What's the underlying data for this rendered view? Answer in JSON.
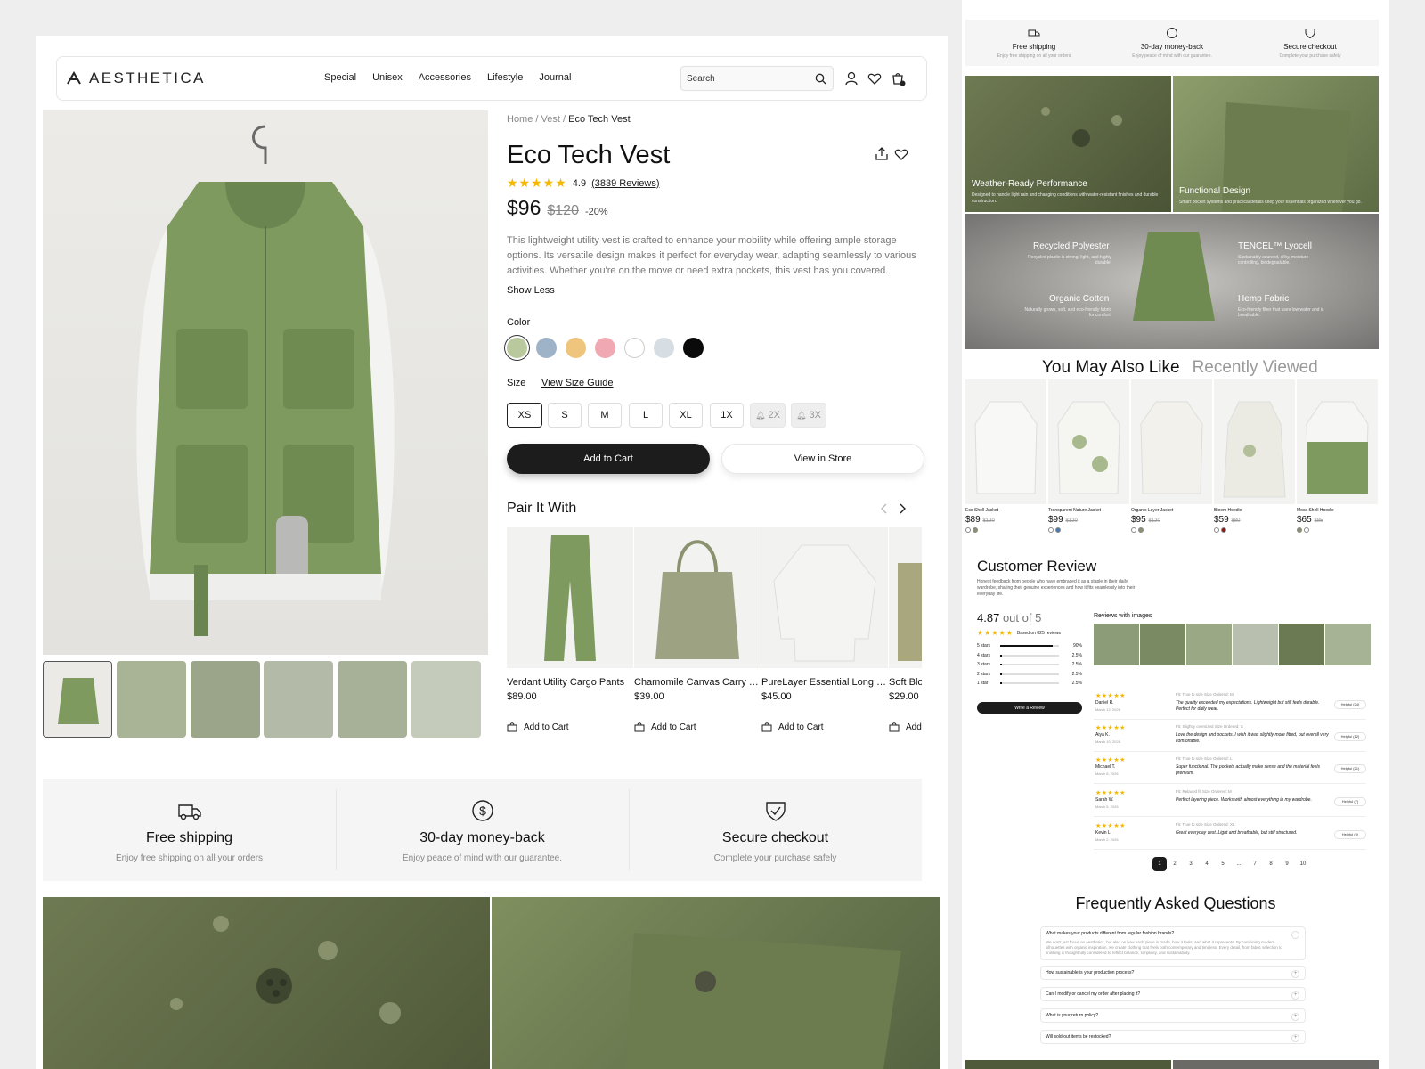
{
  "brand": "AESTHETICA",
  "nav": {
    "links": [
      "Special",
      "Unisex",
      "Accessories",
      "Lifestyle",
      "Journal"
    ],
    "search_placeholder": "Search"
  },
  "breadcrumb": {
    "home": "Home",
    "sep": "/",
    "vest": "Vest",
    "current": "Eco Tech Vest"
  },
  "product": {
    "title": "Eco Tech Vest",
    "rating": "4.9",
    "reviews_link": "(3839 Reviews)",
    "stars": "★★★★★",
    "price": "$96",
    "old_price": "$120",
    "discount": "-20%",
    "description": "This lightweight utility vest is crafted to enhance your mobility while offering ample storage options. Its versatile design makes it perfect for everyday wear, adapting seamlessly to various activities. Whether you're on the move or need extra pockets, this vest has you covered.",
    "show_less": "Show Less",
    "color_label": "Color",
    "colors": [
      "#b9c89d",
      "#9fb3c8",
      "#efc47c",
      "#f0a8b3",
      "#ffffff",
      "#d6dde3",
      "#0a0a0a"
    ],
    "size_label": "Size",
    "size_guide": "View Size Guide",
    "sizes": [
      "XS",
      "S",
      "M",
      "L",
      "XL",
      "1X",
      "2X",
      "3X"
    ],
    "add_to_cart": "Add to Cart",
    "view_in_store": "View in Store"
  },
  "pair": {
    "title": "Pair It With",
    "items": [
      {
        "name": "Verdant Utility Cargo Pants",
        "price": "$89.00",
        "action": "Add to Cart"
      },
      {
        "name": "Chamomile Canvas Carry T...",
        "price": "$39.00",
        "action": "Add to Cart"
      },
      {
        "name": "PureLayer Essential Long Sl...",
        "price": "$45.00",
        "action": "Add to Cart"
      },
      {
        "name": "Soft Blo",
        "price": "$29.00",
        "action": "Add"
      }
    ]
  },
  "features": [
    {
      "title": "Free shipping",
      "sub": "Enjoy free shipping on all your orders"
    },
    {
      "title": "30-day money-back",
      "sub": "Enjoy peace of mind with our guarantee."
    },
    {
      "title": "Secure checkout",
      "sub": "Complete your purchase safely"
    }
  ],
  "right": {
    "overlays": [
      {
        "title": "Weather-Ready Performance",
        "sub": "Designed to handle light rain and changing conditions with water-resistant finishes and durable construction."
      },
      {
        "title": "Functional Design",
        "sub": "Smart pocket systems and practical details keep your essentials organized wherever you go."
      }
    ],
    "materials": [
      {
        "title": "Recycled Polyester",
        "sub": "Recycled plastic is strong, light, and highly durable."
      },
      {
        "title": "TENCEL™ Lyocell",
        "sub": "Sustainably sourced, silky, moisture-controlling, biodegradable."
      },
      {
        "title": "Organic Cotton",
        "sub": "Naturally grown, soft, and eco-friendly fabric for comfort."
      },
      {
        "title": "Hemp Fabric",
        "sub": "Eco-friendly fiber that uses low water and is breathable."
      }
    ],
    "tabs": [
      "You May Also Like",
      "Recently Viewed"
    ],
    "recs": [
      {
        "name": "Eco Shell Jacket",
        "price": "$89",
        "old": "$120",
        "dots": [
          "#ffffff",
          "#8a9270"
        ]
      },
      {
        "name": "Transparent Nature Jacket",
        "price": "$99",
        "old": "$120",
        "dots": [
          "#ffffff",
          "#4a7ab0"
        ]
      },
      {
        "name": "Organic Layer Jacket",
        "price": "$95",
        "old": "$120",
        "dots": [
          "#ffffff",
          "#8a9270"
        ]
      },
      {
        "name": "Bloom Hoodie",
        "price": "$59",
        "old": "$80",
        "dots": [
          "#ffffff",
          "#8a1a1a"
        ]
      },
      {
        "name": "Moss Shell Hoodie",
        "price": "$65",
        "old": "$85",
        "dots": [
          "#8a9270",
          "#ffffff"
        ]
      }
    ],
    "review": {
      "title": "Customer Review",
      "sub": "Honest feedback from people who have embraced it as a staple in their daily wardrobe, sharing their genuine experiences and how it fits seamlessly into their everyday life.",
      "score": "4.87",
      "out_of": "out of 5",
      "based": "Based on 825 reviews",
      "bars": [
        {
          "label": "5 stars",
          "pct": "90%",
          "fill": 0.9
        },
        {
          "label": "4 stars",
          "pct": "2.5%",
          "fill": 0.025
        },
        {
          "label": "3 stars",
          "pct": "2.5%",
          "fill": 0.025
        },
        {
          "label": "2 stars",
          "pct": "2.5%",
          "fill": 0.025
        },
        {
          "label": "1 star",
          "pct": "2.5%",
          "fill": 0.025
        }
      ],
      "write": "Write a Review",
      "with_images": "Reviews with images",
      "items": [
        {
          "name": "Daniel R.",
          "date": "March 12, 2026",
          "fit": "Fit: True to size   Size Ordered: M",
          "text": "The quality exceeded my expectations. Lightweight but still feels durable. Perfect for daily wear.",
          "helpful": "Helpful (24)"
        },
        {
          "name": "Aiya K.",
          "date": "March 10, 2026",
          "fit": "Fit: Slightly oversized   Size Ordered: S",
          "text": "Love the design and pockets. I wish it was slightly more fitted, but overall very comfortable.",
          "helpful": "Helpful (12)"
        },
        {
          "name": "Michael T.",
          "date": "March 8, 2026",
          "fit": "Fit: True to size   Size Ordered: L",
          "text": "Super functional. The pockets actually make sense and the material feels premium.",
          "helpful": "Helpful (21)"
        },
        {
          "name": "Sarah W.",
          "date": "March 5, 2026",
          "fit": "Fit: Relaxed fit   Size Ordered: M",
          "text": "Perfect layering piece. Works with almost everything in my wardrobe.",
          "helpful": "Helpful (7)"
        },
        {
          "name": "Kevin L.",
          "date": "March 2, 2026",
          "fit": "Fit: True to size   Size Ordered: XL",
          "text": "Great everyday vest. Light and breathable, but still structured.",
          "helpful": "Helpful (5)"
        }
      ],
      "pages": [
        "1",
        "2",
        "3",
        "4",
        "5",
        "...",
        "7",
        "8",
        "9",
        "10"
      ]
    },
    "faq": {
      "title": "Frequently Asked Questions",
      "items": [
        {
          "q": "What makes your products different from regular fashion brands?",
          "a": "We don't just focus on aesthetics, but also on how each piece is made, how it feels, and what it represents. By combining modern silhouettes with organic inspiration, we create clothing that feels both contemporary and timeless. Every detail, from fabric selection to finishing is thoughtfully considered to reflect balance, simplicity, and sustainability."
        },
        {
          "q": "How sustainable is your production process?",
          "a": ""
        },
        {
          "q": "Can I modify or cancel my order after placing it?",
          "a": ""
        },
        {
          "q": "What is your return policy?",
          "a": ""
        },
        {
          "q": "Will sold-out items be restocked?",
          "a": ""
        }
      ]
    }
  }
}
